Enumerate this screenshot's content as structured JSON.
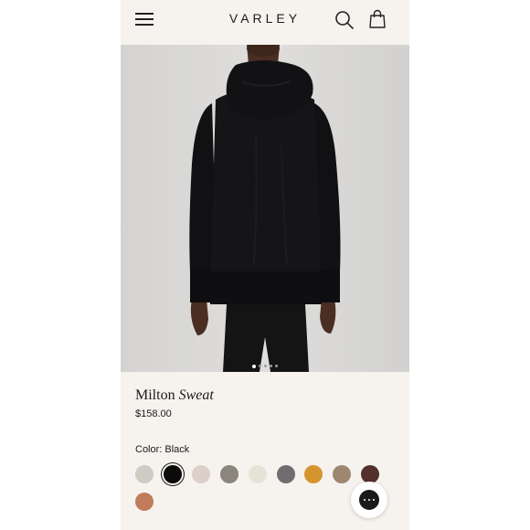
{
  "header": {
    "logo_text": "VARLEY",
    "menu_icon": "hamburger-menu-icon",
    "search_icon": "search-icon",
    "bag_icon": "shopping-bag-icon"
  },
  "gallery": {
    "image_count": 5,
    "active_index": 0
  },
  "product": {
    "name_regular": "Milton",
    "name_italic": "Sweat",
    "price": "$158.00"
  },
  "color_selector": {
    "label": "Color: Black",
    "selected_index": 1,
    "swatches": [
      "#cfcbc2",
      "#0b0b0b",
      "#dccfc9",
      "#8b867c",
      "#e5e3d7",
      "#706d70",
      "#d5952e",
      "#9d8770",
      "#53302b",
      "#c07c5a"
    ]
  },
  "chat": {
    "icon": "chat-bubble-icon"
  },
  "colors": {
    "page_background": "#f6f3ee",
    "text": "#1a1a1a"
  }
}
